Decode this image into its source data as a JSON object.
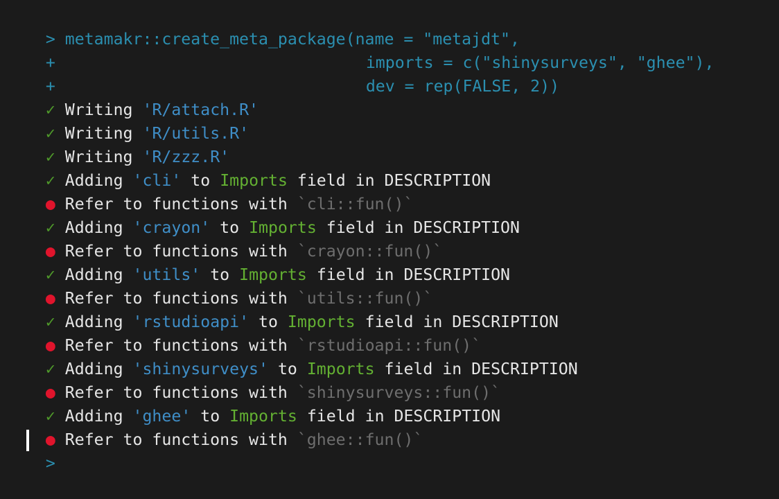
{
  "prompt": {
    "primary": ">",
    "continuation": "+"
  },
  "command": {
    "line1": "metamakr::create_meta_package(name = \"metajdt\",",
    "line2": "imports = c(\"shinysurveys\", \"ghee\"),",
    "line3": "dev = rep(FALSE, 2))"
  },
  "symbols": {
    "check": "✓",
    "bullet": "●"
  },
  "writes": [
    {
      "verb": "Writing",
      "file": "'R/attach.R'"
    },
    {
      "verb": "Writing",
      "file": "'R/utils.R'"
    },
    {
      "verb": "Writing",
      "file": "'R/zzz.R'"
    }
  ],
  "imports": [
    {
      "pkg": "'cli'",
      "fun": "`cli::fun()`"
    },
    {
      "pkg": "'crayon'",
      "fun": "`crayon::fun()`"
    },
    {
      "pkg": "'utils'",
      "fun": "`utils::fun()`"
    },
    {
      "pkg": "'rstudioapi'",
      "fun": "`rstudioapi::fun()`"
    },
    {
      "pkg": "'shinysurveys'",
      "fun": "`shinysurveys::fun()`"
    },
    {
      "pkg": "'ghee'",
      "fun": "`ghee::fun()`"
    }
  ],
  "words": {
    "adding": "Adding",
    "to": "to",
    "imports_field": "Imports",
    "field_in": "field in DESCRIPTION",
    "refer": "Refer to functions with"
  },
  "colors": {
    "background": "#1b1b1b",
    "prompt": "#2b8fb0",
    "check": "#4f9a2a",
    "bullet": "#e0142c",
    "quoted": "#3f8ec7",
    "imports_field": "#63b032",
    "muted": "#6e6e6e"
  }
}
